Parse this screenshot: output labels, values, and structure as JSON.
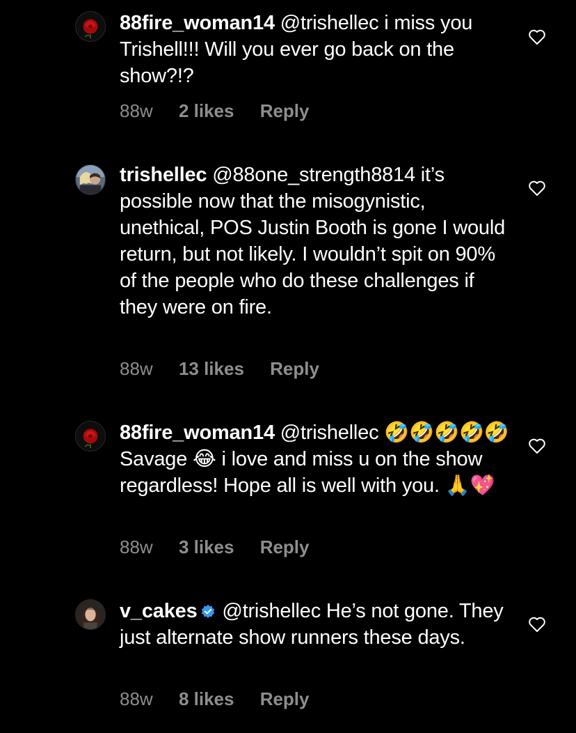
{
  "comments": [
    {
      "username": "88fire_woman14",
      "verified": false,
      "text": "@trishellec i miss you Trishell!!! Will you ever go back on the show?!?",
      "time": "88w",
      "likes": "2 likes",
      "reply": "Reply",
      "avatar_icon": "red-rose-avatar"
    },
    {
      "username": "trishellec",
      "verified": false,
      "text": "@88one_strength8814 it’s possible now that the misogynistic, unethical, POS Justin Booth is gone I would return, but not likely. I wouldn’t spit on 90% of the people who do these challenges if they were on fire.",
      "time": "88w",
      "likes": "13 likes",
      "reply": "Reply",
      "avatar_icon": "photo-avatar"
    },
    {
      "username": "88fire_woman14",
      "verified": false,
      "text": "@trishellec 🤣🤣🤣🤣🤣 Savage 😂 i love and miss u on the show regardless! Hope all is well with you. 🙏💖",
      "time": "88w",
      "likes": "3 likes",
      "reply": "Reply",
      "avatar_icon": "red-rose-avatar"
    },
    {
      "username": "v_cakes",
      "verified": true,
      "text": "@trishellec He’s not gone. They just alternate show runners these days.",
      "time": "88w",
      "likes": "8 likes",
      "reply": "Reply",
      "avatar_icon": "photo-avatar"
    }
  ],
  "colors": {
    "background": "#000000",
    "text": "#ffffff",
    "muted": "#8e8e8e",
    "verified": "#3897f0"
  }
}
